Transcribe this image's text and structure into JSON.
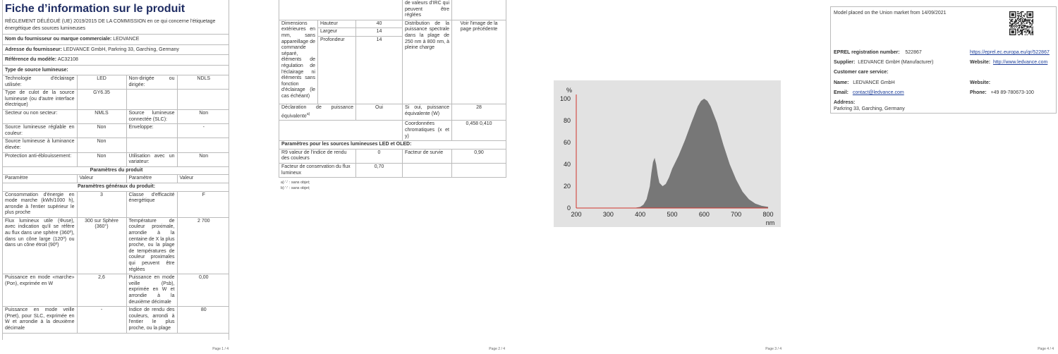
{
  "page1": {
    "title": "Fiche d’information sur le produit",
    "regulation": "RÈGLEMENT DÉLÉGUÉ (UE) 2019/2015 DE LA COMMISSION en ce qui concerne l'étiquetage énergétique des sources lumineuses",
    "supplier_label": "Nom du fournisseur ou marque commerciale:",
    "supplier_value": "LEDVANCE",
    "address_label": "Adresse du fournisseur:",
    "address_value": "LEDVANCE GmbH, Parkring 33, Garching, Germany",
    "model_label": "Référence du modèle:",
    "model_value": "AC32108",
    "source_type_label": "Type de source lumineuse:",
    "rows_a": [
      [
        "Technologie d'éclairage utilisée:",
        "LED",
        "Non-dirigée ou dirigée:",
        "NDLS"
      ],
      [
        "Type de culot de la source lumineuse (ou d'autre interface électrique)",
        "GY6.35",
        "",
        ""
      ],
      [
        "Secteur ou non secteur:",
        "NMLS",
        "Source lumineuse connectée (SLC):",
        "Non"
      ],
      [
        "Source lumineuse réglable en couleur:",
        "Non",
        "Enveloppe:",
        "-"
      ],
      [
        "Source lumineuse à luminance élevée:",
        "Non",
        "",
        ""
      ],
      [
        "Protection anti-éblouissement:",
        "Non",
        "Utilisation avec un variateur:",
        "Non"
      ]
    ],
    "params_title": "Paramètres du produit",
    "params_header": [
      "Paramètre",
      "Valeur",
      "Paramètre",
      "Valeur"
    ],
    "general_title": "Paramètres généraux du produit:",
    "rows_b": [
      [
        "Consommation d'énergie en mode marche (kWh/1000 h), arrondie à l'entier supérieur le plus proche",
        "3",
        "Classe d'efficacité énergétique",
        "F"
      ],
      [
        "Flux lumineux utile (Φuse), avec indication qu'il se réfère au flux dans une sphère (360º), dans un cône large (120º) ou dans un cône étroit (90º)",
        "300 sur Sphère (360°)",
        "Température de couleur proximale, arrondie à la centaine de X la plus proche, ou la plage de températures de couleur proximales qui peuvent être réglées",
        "2 700"
      ],
      [
        "Puissance en mode «marche» (Pon), exprimée en W",
        "2,6",
        "Puissance en mode veille (Psb), exprimée en W et arrondie à la deuxième décimale",
        "0,00"
      ],
      [
        "Puissance en mode veille (Pnet), pour SLC, exprimée en W et arrondie à la deuxième décimale",
        "-",
        "Indice de rendu des couleurs, arrondi à l'entier le plus proche, ou la plage",
        "80"
      ]
    ],
    "page_num": "Page 1 / 4"
  },
  "page2": {
    "top_cell": "de valeurs d'IRC qui peuvent être réglées",
    "dims_label": "Dimensions extérieures en mm, sans appareillage de commande séparé, éléments de régulation de l'éclairage ni éléments sans fonction d'éclairage (le cas échéant)",
    "dims": [
      [
        "Hauteur",
        "40"
      ],
      [
        "Largeur",
        "14"
      ],
      [
        "Profondeur",
        "14"
      ]
    ],
    "spectral_label": "Distribution de la puissance spectrale dans la plage de 250 nm à 800 nm, à pleine charge",
    "spectral_value": "Voir l'image de la page précédente",
    "equiv_label": "Déclaration de puissance équivalente",
    "equiv_sup": "a)",
    "equiv_value": "Oui",
    "equiv_power_label": "Si oui, puissance équivalente (W)",
    "equiv_power_value": "28",
    "chroma_label": "Coordonnées chromatiques (x et y)",
    "chroma_value": "0,458 0,410",
    "led_title": "Paramètres pour les sources lumineuses LED et OLED:",
    "r9_label": "R9 valeur de l'indice de rendu des couleurs",
    "r9_value": "0",
    "survival_label": "Facteur de survie",
    "survival_value": "0,90",
    "flux_label": "Facteur de conservation du flux lumineux",
    "flux_value": "0,70",
    "footnote_a": "a) '-' : sans objet;",
    "footnote_b": "b) '-' : sans objet;",
    "page_num": "Page 2 / 4"
  },
  "page3": {
    "page_num": "Page 3 / 4"
  },
  "chart_data": {
    "type": "area",
    "xlabel": "nm",
    "ylabel": "%",
    "xlim": [
      200,
      800
    ],
    "ylim": [
      0,
      100
    ],
    "xticks": [
      200,
      300,
      400,
      500,
      600,
      700,
      800
    ],
    "yticks": [
      0,
      20,
      40,
      60,
      80,
      100
    ],
    "grid": false,
    "fill_color": "#777777",
    "axis_color": "#d0342c",
    "x": [
      380,
      400,
      410,
      420,
      430,
      435,
      440,
      445,
      450,
      455,
      460,
      470,
      480,
      490,
      500,
      520,
      540,
      560,
      580,
      590,
      600,
      610,
      620,
      640,
      660,
      680,
      700,
      720,
      740,
      760,
      780,
      800
    ],
    "values": [
      0,
      1,
      3,
      8,
      20,
      32,
      42,
      46,
      40,
      30,
      23,
      20,
      22,
      28,
      36,
      48,
      62,
      78,
      93,
      98,
      100,
      98,
      93,
      78,
      58,
      40,
      26,
      15,
      8,
      4,
      2,
      1
    ]
  },
  "page4": {
    "model_placed": "Model placed on the Union market from 14/09/2021",
    "eprel_label": "EPREL registration number:",
    "eprel_value": "522867",
    "eprel_link": "https://eprel.ec.europa.eu/qr/522867",
    "supplier_label": "Supplier:",
    "supplier_value": "LEDVANCE GmbH (Manufacturer)",
    "website_label": "Website:",
    "website_link": "http://www.ledvance.com",
    "care_title": "Customer care service:",
    "name_label": "Name:",
    "name_value": "LEDVANCE GmbH",
    "website2_label": "Website:",
    "email_label": "Email:",
    "email_value": "contact@ledvance.com",
    "phone_label": "Phone:",
    "phone_value": "+49 89-780673-100",
    "address_label": "Address:",
    "address_value": "Parkring 33, Garching, Germany",
    "page_num": "Page 4 / 4"
  }
}
